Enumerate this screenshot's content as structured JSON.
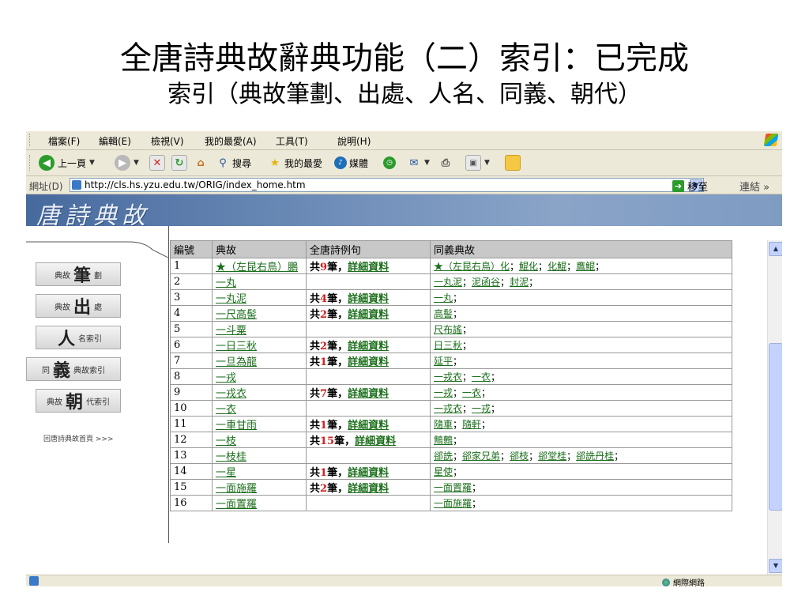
{
  "slide": {
    "title": "全唐詩典故辭典功能（二）索引：已完成",
    "subtitle": "索引（典故筆劃、出處、人名、同義、朝代）"
  },
  "menubar": [
    "檔案(F)",
    "編輯(E)",
    "檢視(V)",
    "我的最愛(A)",
    "工具(T)",
    "說明(H)"
  ],
  "toolbar": {
    "back_label": "上一頁",
    "search_label": "搜尋",
    "favorites_label": "我的最愛",
    "media_label": "媒體"
  },
  "address": {
    "label": "網址(D)",
    "url": "http://cls.hs.yzu.edu.tw/ORIG/index_home.htm",
    "go_label": "移至",
    "links_label": "連結 »"
  },
  "banner": {
    "title": "唐詩典故"
  },
  "nav": {
    "items": [
      {
        "small_left": "典故",
        "big": "筆",
        "small_right": "劃"
      },
      {
        "small_left": "典故",
        "big": "出",
        "small_right": "處"
      },
      {
        "small_left": "",
        "big": "人",
        "small_right": "名索引"
      },
      {
        "small_left": "同",
        "big": "義",
        "small_right": "典故索引"
      },
      {
        "small_left": "典故",
        "big": "朝",
        "small_right": "代索引"
      }
    ],
    "back_home": "回唐詩典故首頁 >>>"
  },
  "table": {
    "headers": [
      "編號",
      "典故",
      "全唐詩例句",
      "同義典故"
    ],
    "count_prefix": "共",
    "count_suffix": "筆，",
    "detail_label": "詳細資料",
    "rows": [
      {
        "no": "1",
        "term": "★（左昆右鳥）鵬",
        "count": "9",
        "synonyms": [
          "★（左昆右鳥）化",
          "鯤化",
          "化鯤",
          "鷹鯤"
        ]
      },
      {
        "no": "2",
        "term": "一丸",
        "count": "",
        "synonyms": [
          "一丸泥",
          "泥函谷",
          "封泥"
        ]
      },
      {
        "no": "3",
        "term": "一丸泥",
        "count": "4",
        "synonyms": [
          "一丸"
        ]
      },
      {
        "no": "4",
        "term": "一尺高髻",
        "count": "2",
        "synonyms": [
          "高髻"
        ]
      },
      {
        "no": "5",
        "term": "一斗粟",
        "count": "",
        "synonyms": [
          "尺布謠"
        ]
      },
      {
        "no": "6",
        "term": "一日三秋",
        "count": "2",
        "synonyms": [
          "日三秋"
        ]
      },
      {
        "no": "7",
        "term": "一旦為龍",
        "count": "1",
        "synonyms": [
          "延平"
        ]
      },
      {
        "no": "8",
        "term": "一戎",
        "count": "",
        "synonyms": [
          "一戎衣",
          "一衣"
        ]
      },
      {
        "no": "9",
        "term": "一戎衣",
        "count": "7",
        "synonyms": [
          "一戎",
          "一衣"
        ]
      },
      {
        "no": "10",
        "term": "一衣",
        "count": "",
        "synonyms": [
          "一戎衣",
          "一戎"
        ]
      },
      {
        "no": "11",
        "term": "一車甘雨",
        "count": "1",
        "synonyms": [
          "隨車",
          "隨軒"
        ]
      },
      {
        "no": "12",
        "term": "一枝",
        "count": "15",
        "synonyms": [
          "鷦鷯"
        ]
      },
      {
        "no": "13",
        "term": "一枝桂",
        "count": "",
        "synonyms": [
          "郤詵",
          "郤家兄弟",
          "郤枝",
          "郤堂桂",
          "郤詵丹桂"
        ]
      },
      {
        "no": "14",
        "term": "一星",
        "count": "1",
        "synonyms": [
          "星使"
        ]
      },
      {
        "no": "15",
        "term": "一面施羅",
        "count": "2",
        "synonyms": [
          "一面置羅"
        ]
      },
      {
        "no": "16",
        "term": "一面置羅",
        "count": "",
        "synonyms": [
          "一面施羅"
        ]
      }
    ]
  },
  "status": {
    "zone": "網際網路"
  }
}
